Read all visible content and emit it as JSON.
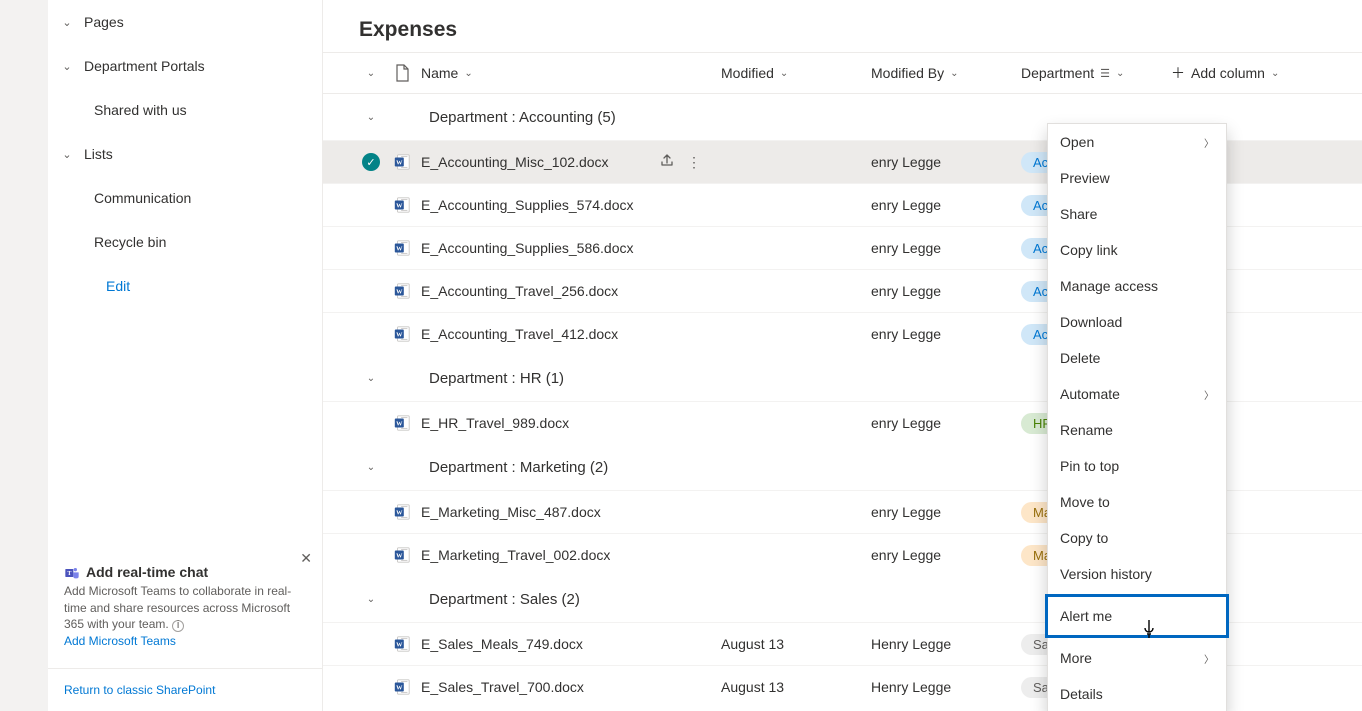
{
  "page": {
    "title": "Expenses"
  },
  "sidebar": {
    "items": [
      {
        "label": "Pages",
        "hasChevron": true
      },
      {
        "label": "Department Portals",
        "hasChevron": true
      },
      {
        "label": "Shared with us",
        "hasChevron": false,
        "child": true
      },
      {
        "label": "Lists",
        "hasChevron": true
      },
      {
        "label": "Communication",
        "hasChevron": false,
        "child": true
      },
      {
        "label": "Recycle bin",
        "hasChevron": false,
        "child": true
      }
    ],
    "edit_label": "Edit"
  },
  "promo": {
    "title": "Add real-time chat",
    "body": "Add Microsoft Teams to collaborate in real-time and share resources across Microsoft 365 with your team.",
    "link": "Add Microsoft Teams"
  },
  "classic_link": "Return to classic SharePoint",
  "columns": {
    "name": "Name",
    "modified": "Modified",
    "modified_by": "Modified By",
    "department": "Department",
    "add": "Add column"
  },
  "groups": [
    {
      "label": "Department : Accounting (5)",
      "rows": [
        {
          "name": "E_Accounting_Misc_102.docx",
          "modified_by": "enry Legge",
          "dept": "Accounting",
          "selected": true
        },
        {
          "name": "E_Accounting_Supplies_574.docx",
          "modified_by": "enry Legge",
          "dept": "Accounting"
        },
        {
          "name": "E_Accounting_Supplies_586.docx",
          "modified_by": "enry Legge",
          "dept": "Accounting"
        },
        {
          "name": "E_Accounting_Travel_256.docx",
          "modified_by": "enry Legge",
          "dept": "Accounting"
        },
        {
          "name": "E_Accounting_Travel_412.docx",
          "modified_by": "enry Legge",
          "dept": "Accounting"
        }
      ]
    },
    {
      "label": "Department : HR (1)",
      "rows": [
        {
          "name": "E_HR_Travel_989.docx",
          "modified_by": "enry Legge",
          "dept": "HR"
        }
      ]
    },
    {
      "label": "Department : Marketing (2)",
      "rows": [
        {
          "name": "E_Marketing_Misc_487.docx",
          "modified_by": "enry Legge",
          "dept": "Marketing"
        },
        {
          "name": "E_Marketing_Travel_002.docx",
          "modified_by": "enry Legge",
          "dept": "Marketing"
        }
      ]
    },
    {
      "label": "Department : Sales (2)",
      "rows": [
        {
          "name": "E_Sales_Meals_749.docx",
          "modified": "August 13",
          "modified_by": "Henry Legge",
          "dept": "Sales"
        },
        {
          "name": "E_Sales_Travel_700.docx",
          "modified": "August 13",
          "modified_by": "Henry Legge",
          "dept": "Sales"
        }
      ]
    }
  ],
  "context_menu": {
    "items": [
      {
        "label": "Open",
        "sub": true
      },
      {
        "label": "Preview"
      },
      {
        "label": "Share"
      },
      {
        "label": "Copy link"
      },
      {
        "label": "Manage access"
      },
      {
        "label": "Download"
      },
      {
        "label": "Delete"
      },
      {
        "label": "Automate",
        "sub": true
      },
      {
        "label": "Rename"
      },
      {
        "label": "Pin to top"
      },
      {
        "label": "Move to"
      },
      {
        "label": "Copy to"
      },
      {
        "label": "Version history"
      },
      {
        "label": "Alert me",
        "highlight": true
      },
      {
        "label": "More",
        "sub": true
      },
      {
        "label": "Details"
      }
    ]
  }
}
